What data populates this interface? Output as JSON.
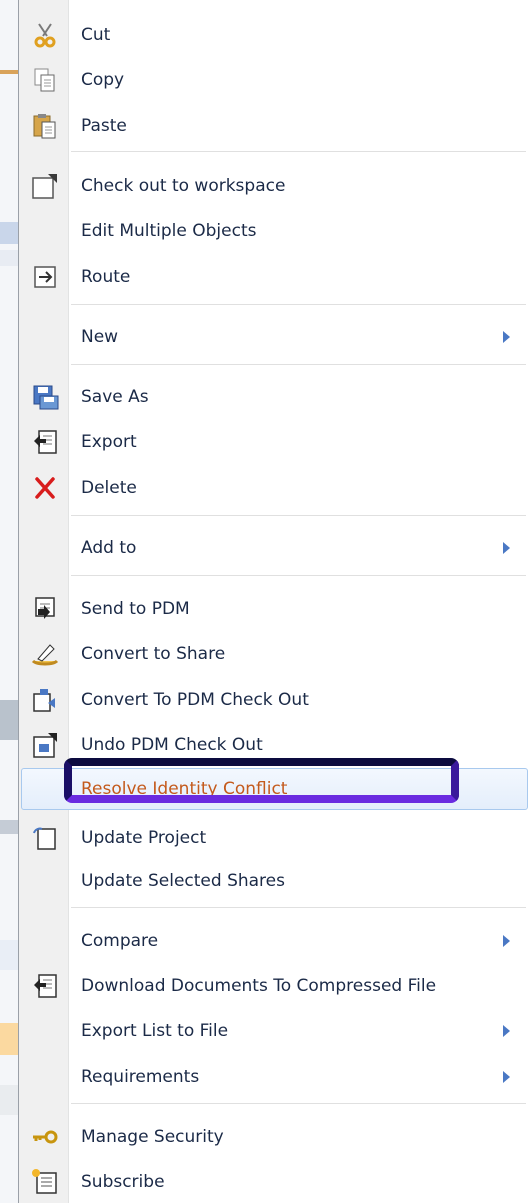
{
  "menu": {
    "items": [
      {
        "label": "Cut",
        "icon": "scissors-icon"
      },
      {
        "label": "Copy",
        "icon": "copy-icon"
      },
      {
        "label": "Paste",
        "icon": "paste-icon"
      },
      {
        "label": "Check out to workspace",
        "icon": "checkout-icon"
      },
      {
        "label": "Edit Multiple Objects",
        "icon": ""
      },
      {
        "label": "Route",
        "icon": "route-icon"
      },
      {
        "label": "New",
        "icon": "",
        "submenu": true
      },
      {
        "label": "Save As",
        "icon": "save-as-icon"
      },
      {
        "label": "Export",
        "icon": "export-icon"
      },
      {
        "label": "Delete",
        "icon": "delete-icon"
      },
      {
        "label": "Add to",
        "icon": "",
        "submenu": true
      },
      {
        "label": "Send to PDM",
        "icon": "send-to-pdm-icon"
      },
      {
        "label": "Convert to Share",
        "icon": "convert-to-share-icon"
      },
      {
        "label": "Convert To PDM Check Out",
        "icon": "convert-to-pdm-icon"
      },
      {
        "label": "Undo PDM Check Out",
        "icon": "undo-pdm-icon"
      },
      {
        "label": "Resolve Identity Conflict",
        "icon": "",
        "highlighted": true
      },
      {
        "label": "Update Project",
        "icon": "update-project-icon"
      },
      {
        "label": "Update Selected Shares",
        "icon": ""
      },
      {
        "label": "Compare",
        "icon": "",
        "submenu": true
      },
      {
        "label": "Download Documents To Compressed File",
        "icon": "download-icon"
      },
      {
        "label": "Export List to File",
        "icon": "",
        "submenu": true
      },
      {
        "label": "Requirements",
        "icon": "",
        "submenu": true
      },
      {
        "label": "Manage Security",
        "icon": "key-icon"
      },
      {
        "label": "Subscribe",
        "icon": "subscribe-icon"
      }
    ]
  },
  "colors": {
    "label": "#1b2a47",
    "highlight_label": "#c45a1c",
    "submenu_arrow": "#4a78c4",
    "callout_border": "#3a1a9c"
  }
}
